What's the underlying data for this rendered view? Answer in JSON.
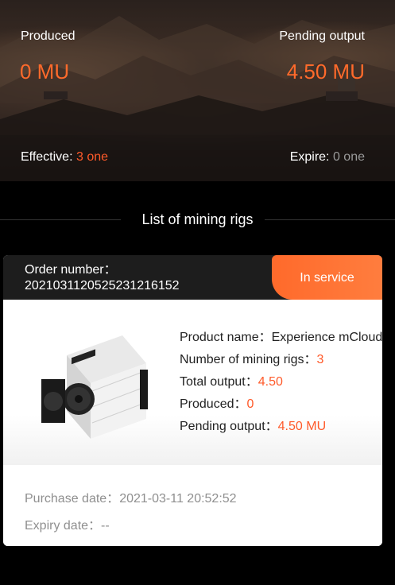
{
  "summary": {
    "produced_label": "Produced",
    "produced_value": "0 MU",
    "pending_label": "Pending output",
    "pending_value": "4.50 MU",
    "effective_label": "Effective:",
    "effective_value": "3 one",
    "expire_label": "Expire:",
    "expire_value": "0 one"
  },
  "section_title": "List of mining rigs",
  "rigs": [
    {
      "order_label": "Order number：",
      "order_number": "20210311205252312161​52",
      "status": "In service",
      "product_name_label": "Product name：",
      "product_name_value": "Experience mCloud",
      "rig_count_label": "Number of mining rigs：",
      "rig_count_value": "3",
      "total_output_label": "Total output：",
      "total_output_value": "4.50",
      "produced_label": "Produced：",
      "produced_value": "0",
      "pending_label": "Pending output：",
      "pending_value": "4.50 MU",
      "purchase_date_label": "Purchase date：",
      "purchase_date_value": "2021-03-11 20:52:52",
      "expiry_date_label": "Expiry date：",
      "expiry_date_value": "--"
    }
  ],
  "colors": {
    "accent": "#ff6a2b",
    "card_header": "#1d1d1d",
    "muted": "#8f8f8f"
  }
}
